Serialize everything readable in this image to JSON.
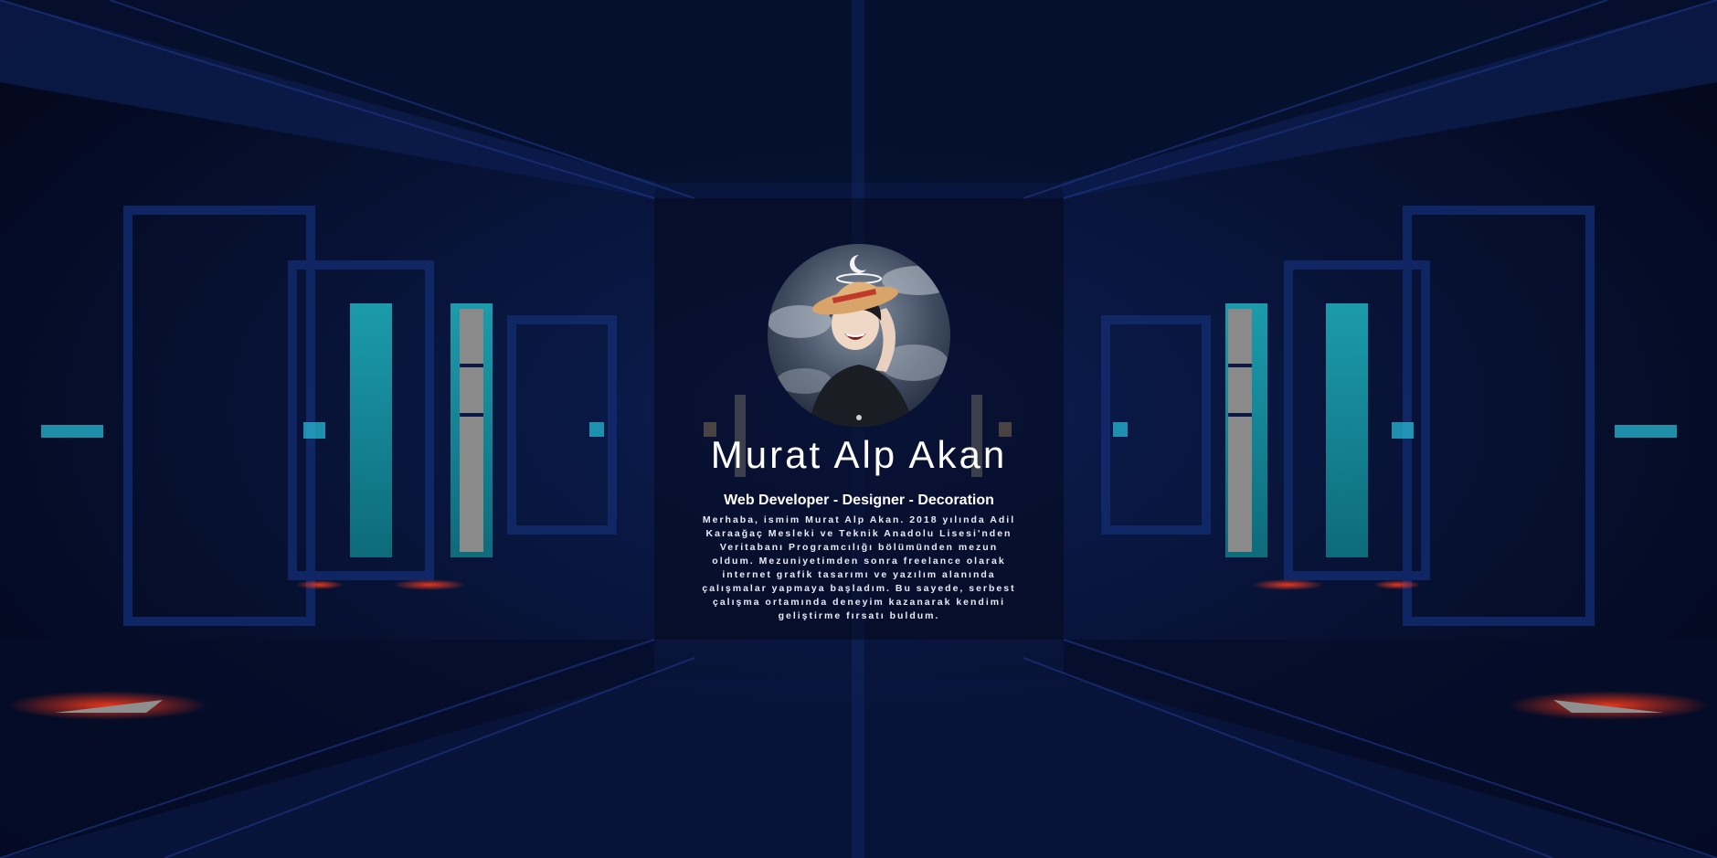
{
  "profile": {
    "name": "Murat Alp Akan",
    "tagline": "Web Developer - Designer - Decoration",
    "bio": "Merhaba, ismim Murat Alp Akan. 2018 yılında Adil Karaağaç Mesleki ve Teknik Anadolu Lisesi'nden Veritabanı Programcılığı bölümünden mezun oldum. Mezuniyetimden sonra freelance olarak internet grafik tasarımı ve yazılım alanında çalışmalar yapmaya başladım. Bu sayede, serbest çalışma ortamında deneyim kazanarak kendimi geliştirme fırsatı buldum.",
    "avatar_icon": "avatar-anime-character"
  },
  "colors": {
    "background": "#071235",
    "accent_cyan": "#1fb3c0",
    "accent_red": "#d0281e",
    "text": "#ffffff"
  }
}
